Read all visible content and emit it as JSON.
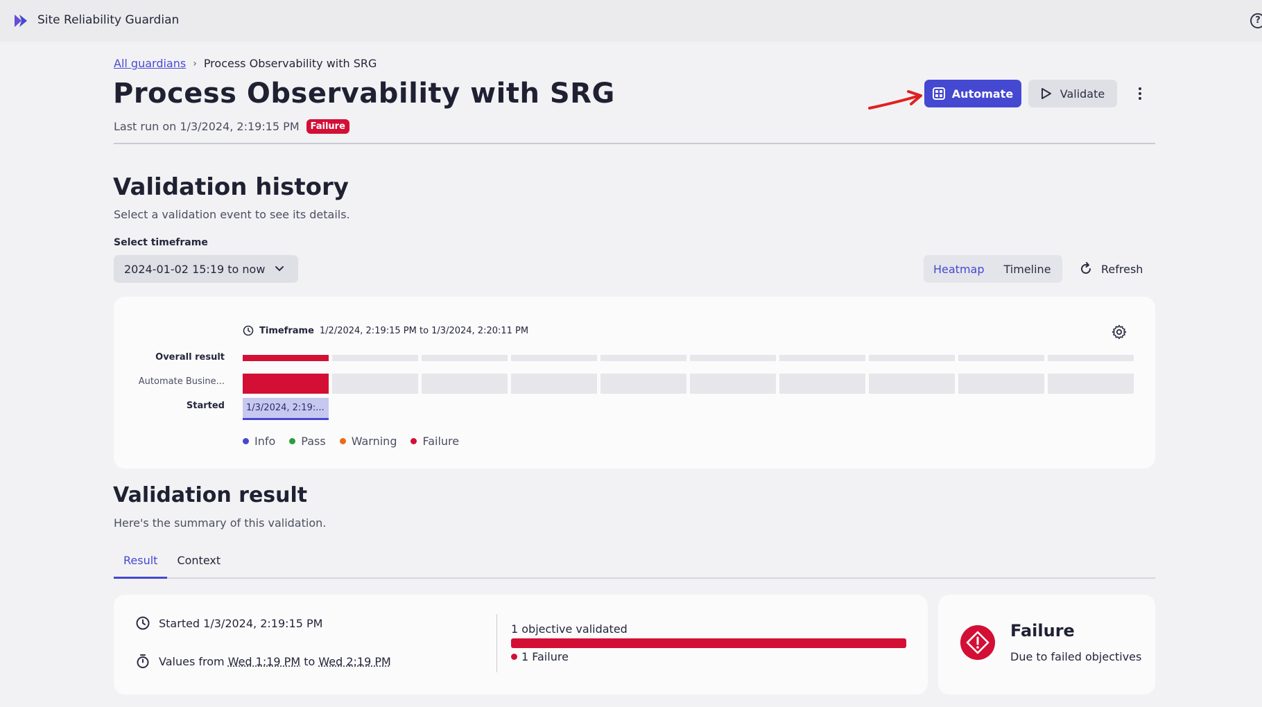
{
  "app": {
    "title": "Site Reliability Guardian",
    "help_glyph": "?"
  },
  "breadcrumb": {
    "root": "All guardians",
    "separator": "›",
    "current": "Process Observability with SRG"
  },
  "header": {
    "title": "Process Observability with SRG",
    "last_run": "Last run on 1/3/2024, 2:19:15 PM",
    "status_badge": "Failure",
    "automate_label": "Automate",
    "validate_label": "Validate"
  },
  "history": {
    "title": "Validation history",
    "subtitle": "Select a validation event to see its details.",
    "timeframe_label": "Select timeframe",
    "timeframe_value": "2024-01-02 15:19 to now",
    "view_options": [
      "Heatmap",
      "Timeline"
    ],
    "active_view": "Heatmap",
    "refresh_label": "Refresh",
    "heatmap": {
      "timeframe_prefix": "Timeframe",
      "timeframe_range": "1/2/2024, 2:19:15 PM to 1/3/2024, 2:20:11 PM",
      "rows": {
        "overall": "Overall result",
        "objective": "Automate Busine...",
        "started": "Started"
      },
      "started_value": "1/3/2024, 2:19:...",
      "columns": 10,
      "results": [
        "Failure",
        "",
        "",
        "",
        "",
        "",
        "",
        "",
        "",
        ""
      ]
    },
    "legend": [
      {
        "label": "Info",
        "color": "#4548d1"
      },
      {
        "label": "Pass",
        "color": "#2a9d3c"
      },
      {
        "label": "Warning",
        "color": "#ee6a16"
      },
      {
        "label": "Failure",
        "color": "#d30f36"
      }
    ]
  },
  "result": {
    "title": "Validation result",
    "subtitle": "Here's the summary of this validation.",
    "tabs": [
      "Result",
      "Context"
    ],
    "active_tab": "Result",
    "started": "Started 1/3/2024, 2:19:15 PM",
    "values_from_prefix": "Values from",
    "values_from_start": "Wed 1:19 PM",
    "values_to_word": "to",
    "values_from_end": "Wed 2:19 PM",
    "objectives_label": "1 objective validated",
    "objectives_failed": 1,
    "objectives_total": 1,
    "objectives_legend": "1 Failure",
    "status_title": "Failure",
    "status_subtitle": "Due to failed objectives"
  },
  "colors": {
    "accent": "#4548d1",
    "failure": "#d30f36",
    "annotation_arrow": "#e02020"
  }
}
